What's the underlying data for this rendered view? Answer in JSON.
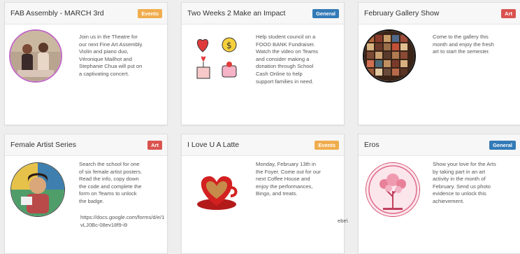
{
  "cards": [
    {
      "title": "FAB Assembly - MARCH 3rd",
      "badge": "Events",
      "description": "Join us in the Theatre for\nour next Fine Art Assembly.\nViolin and piano duo,\nVéronique Mailhot and\nStephanie Chua will put on\na captivating concert."
    },
    {
      "title": "Two Weeks 2 Make an Impact",
      "badge": "General",
      "description": "Help student council on a\nFOOD BANK Fundraiser.\nWatch the video on Teams\nand consider making a\ndonation through School\nCash Online to help\nsupport families in need."
    },
    {
      "title": "February Gallery Show",
      "badge": "Art",
      "description": "Come to the gallery this\nmonth and enjoy the fresh\nart to start the semester."
    },
    {
      "title": "Female Artist Series",
      "badge": "Art",
      "description": "Search the school for one\nof six female artist posters.\nRead the info, copy down\nthe code and complete the\nform on Teams to unlock\nthe badge.",
      "link": "https://docs.google.com/forms/d/e/1\nvLJ0Bc-08ev18f9-i9"
    },
    {
      "title": "I Love U A Latte",
      "badge": "Events",
      "description": "Monday, February 13th in\nthe Foyer. Come out for our\nnext Coffee House and\nenjoy the performances,\nBingo, and treats."
    },
    {
      "title": "Eros",
      "badge": "General",
      "description": "Show your love for the Arts\nby taking part in an art\nactivity in the month of\nFebruary. Send us photo\nevidence to unlock this\nachievement."
    }
  ],
  "ghost_text": "ebe\\"
}
